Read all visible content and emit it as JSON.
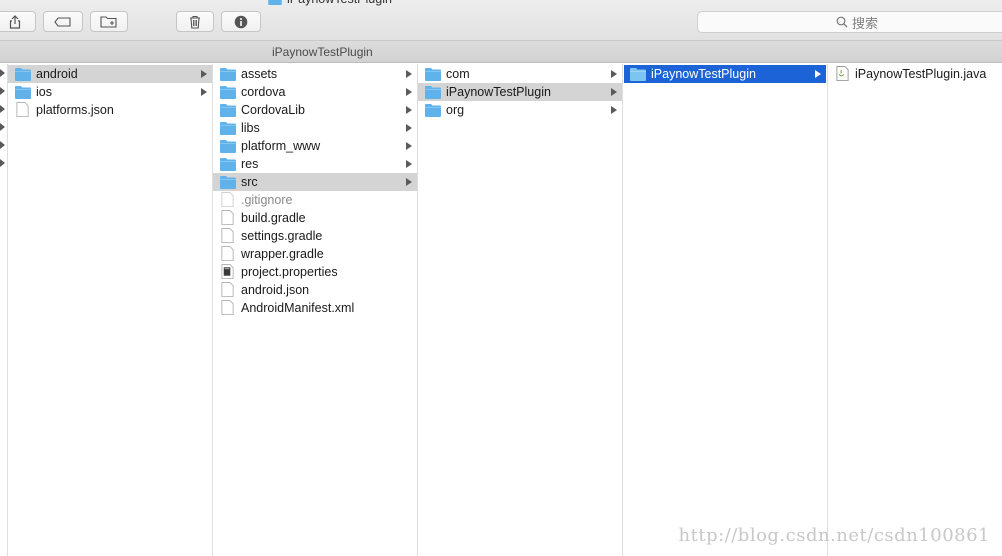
{
  "window_title": "iPaynowTestPlugin",
  "toolbar": {
    "buttons": [
      "share-icon",
      "tag-icon",
      "new-folder-icon",
      "trash-icon",
      "info-icon"
    ]
  },
  "search": {
    "placeholder": "搜索"
  },
  "pathbar": {
    "title": "iPaynowTestPlugin"
  },
  "columns": {
    "c1": [
      "android",
      "ios",
      "platforms.json"
    ],
    "c2": [
      "assets",
      "cordova",
      "CordovaLib",
      "libs",
      "platform_www",
      "res",
      "src",
      ".gitignore",
      "build.gradle",
      "settings.gradle",
      "wrapper.gradle",
      "project.properties",
      "android.json",
      "AndroidManifest.xml"
    ],
    "c3": [
      "com",
      "iPaynowTestPlugin",
      "org"
    ],
    "c4": [
      "iPaynowTestPlugin"
    ],
    "c5": [
      "iPaynowTestPlugin.java"
    ]
  },
  "selection": {
    "c1": "android",
    "c2": "src",
    "c3": "iPaynowTestPlugin",
    "c4": "iPaynowTestPlugin"
  },
  "colors": {
    "folder": "#5fb3ea",
    "selected_blue": "#1b63d6",
    "selected_gray": "#d4d4d4"
  },
  "watermark": "http://blog.csdn.net/csdn100861"
}
